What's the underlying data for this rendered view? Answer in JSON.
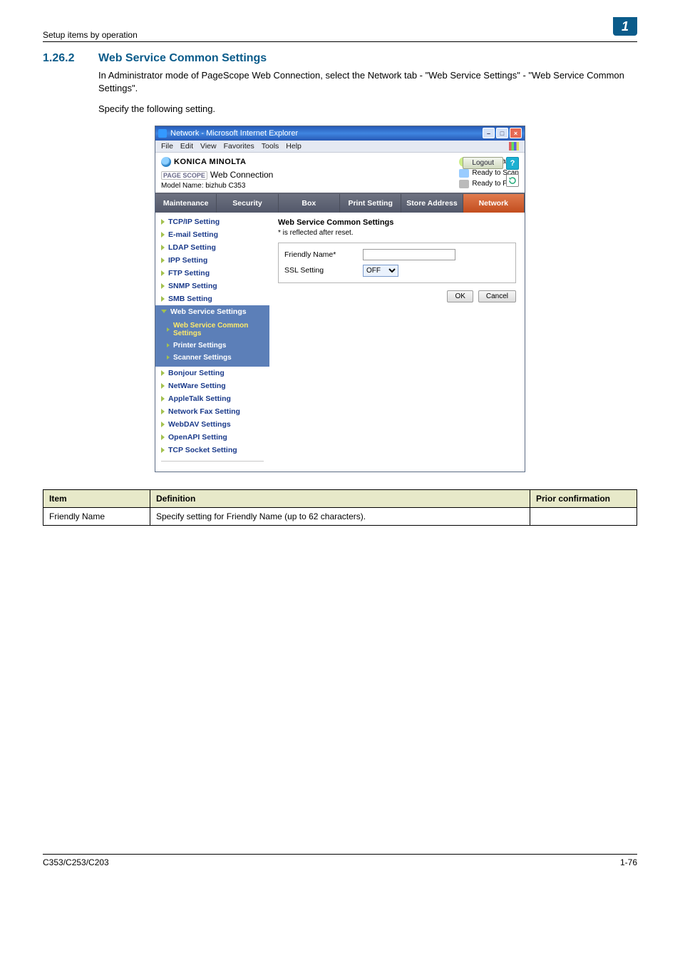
{
  "breadcrumb": "Setup items by operation",
  "chapter_number": "1",
  "section": {
    "number": "1.26.2",
    "title": "Web Service Common Settings"
  },
  "intro_paragraph": "In Administrator mode of PageScope Web Connection, select the Network tab - \"Web Service Settings\" - \"Web Service Common Settings\".",
  "intro_instruction": "Specify the following setting.",
  "browser": {
    "title": "Network - Microsoft Internet Explorer",
    "menus": [
      "File",
      "Edit",
      "View",
      "Favorites",
      "Tools",
      "Help"
    ]
  },
  "app": {
    "brand": "KONICA MINOLTA",
    "pagescope_prefix": "PAGE SCOPE",
    "pagescope_label": "Web Connection",
    "model_name": "Model Name: bizhub C353",
    "admin_label": "Administrator",
    "status_scan": "Ready to Scan",
    "status_print": "Ready to Print",
    "logout_label": "Logout",
    "help_label": "?",
    "tabs": [
      "Maintenance",
      "Security",
      "Box",
      "Print Setting",
      "Store Address",
      "Network"
    ],
    "active_tab_index": 5,
    "sidebar": [
      {
        "label": "TCP/IP Setting"
      },
      {
        "label": "E-mail Setting"
      },
      {
        "label": "LDAP Setting"
      },
      {
        "label": "IPP Setting"
      },
      {
        "label": "FTP Setting"
      },
      {
        "label": "SNMP Setting"
      },
      {
        "label": "SMB Setting"
      },
      {
        "label": "Web Service Settings",
        "expanded": true,
        "children": [
          {
            "label": "Web Service Common Settings",
            "selected": true
          },
          {
            "label": "Printer Settings"
          },
          {
            "label": "Scanner Settings"
          }
        ]
      },
      {
        "label": "Bonjour Setting"
      },
      {
        "label": "NetWare Setting"
      },
      {
        "label": "AppleTalk Setting"
      },
      {
        "label": "Network Fax Setting"
      },
      {
        "label": "WebDAV Settings"
      },
      {
        "label": "OpenAPI Setting"
      },
      {
        "label": "TCP Socket Setting"
      }
    ],
    "content": {
      "heading": "Web Service Common Settings",
      "reset_note": "* is reflected after reset.",
      "friendly_name_label": "Friendly Name*",
      "friendly_name_value": "",
      "ssl_label": "SSL Setting",
      "ssl_value": "OFF",
      "ok_label": "OK",
      "cancel_label": "Cancel"
    }
  },
  "def_table": {
    "headers": {
      "item": "Item",
      "definition": "Definition",
      "prior": "Prior confirmation"
    },
    "rows": [
      {
        "item": "Friendly Name",
        "definition": "Specify setting for Friendly Name (up to 62 characters).",
        "prior": ""
      }
    ]
  },
  "footer": {
    "model": "C353/C253/C203",
    "page": "1-76"
  }
}
